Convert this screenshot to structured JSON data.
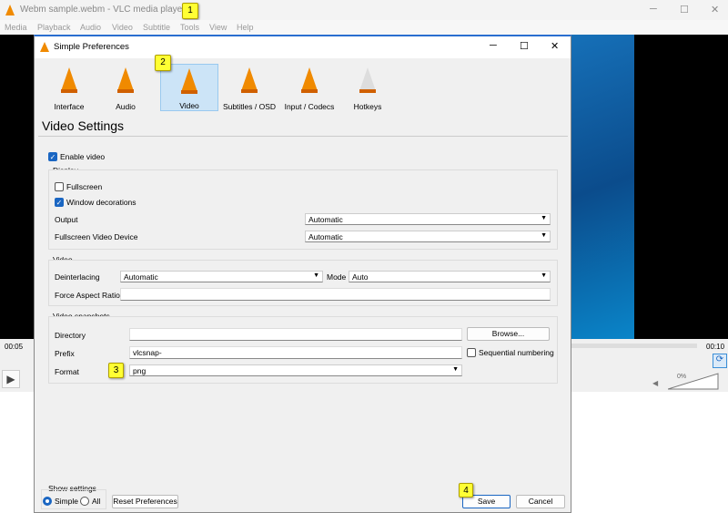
{
  "main_window": {
    "title": "Webm sample.webm - VLC media player",
    "menu": [
      "Media",
      "Playback",
      "Audio",
      "Video",
      "Subtitle",
      "Tools",
      "View",
      "Help"
    ],
    "time_elapsed": "00:05",
    "time_total": "00:10",
    "volume": "0%"
  },
  "dialog": {
    "title": "Simple Preferences",
    "categories": [
      "Interface",
      "Audio",
      "Video",
      "Subtitles / OSD",
      "Input / Codecs",
      "Hotkeys"
    ],
    "selected_category": "Video",
    "heading": "Video Settings",
    "enable_video": {
      "label": "Enable video",
      "checked": true
    },
    "display": {
      "title": "Display",
      "fullscreen": {
        "label": "Fullscreen",
        "checked": false
      },
      "window_decorations": {
        "label": "Window decorations",
        "checked": true
      },
      "output_label": "Output",
      "output_value": "Automatic",
      "fs_device_label": "Fullscreen Video Device",
      "fs_device_value": "Automatic"
    },
    "video": {
      "title": "Video",
      "deinterlacing_label": "Deinterlacing",
      "deinterlacing_value": "Automatic",
      "mode_label": "Mode",
      "mode_value": "Auto",
      "aspect_label": "Force Aspect Ratio",
      "aspect_value": ""
    },
    "snapshots": {
      "title": "Video snapshots",
      "directory_label": "Directory",
      "directory_value": "",
      "browse": "Browse...",
      "prefix_label": "Prefix",
      "prefix_value": "vlcsnap-",
      "sequential": {
        "label": "Sequential numbering",
        "checked": false
      },
      "format_label": "Format",
      "format_value": "png"
    },
    "show_settings": {
      "title": "Show settings",
      "simple": "Simple",
      "all": "All",
      "selected": "Simple"
    },
    "reset": "Reset Preferences",
    "save": "Save",
    "cancel": "Cancel"
  },
  "badges": [
    "1",
    "2",
    "3",
    "4"
  ],
  "colors": {
    "badge": "#ffff33",
    "accent": "#1a66c2",
    "cone": "#f08a00"
  }
}
